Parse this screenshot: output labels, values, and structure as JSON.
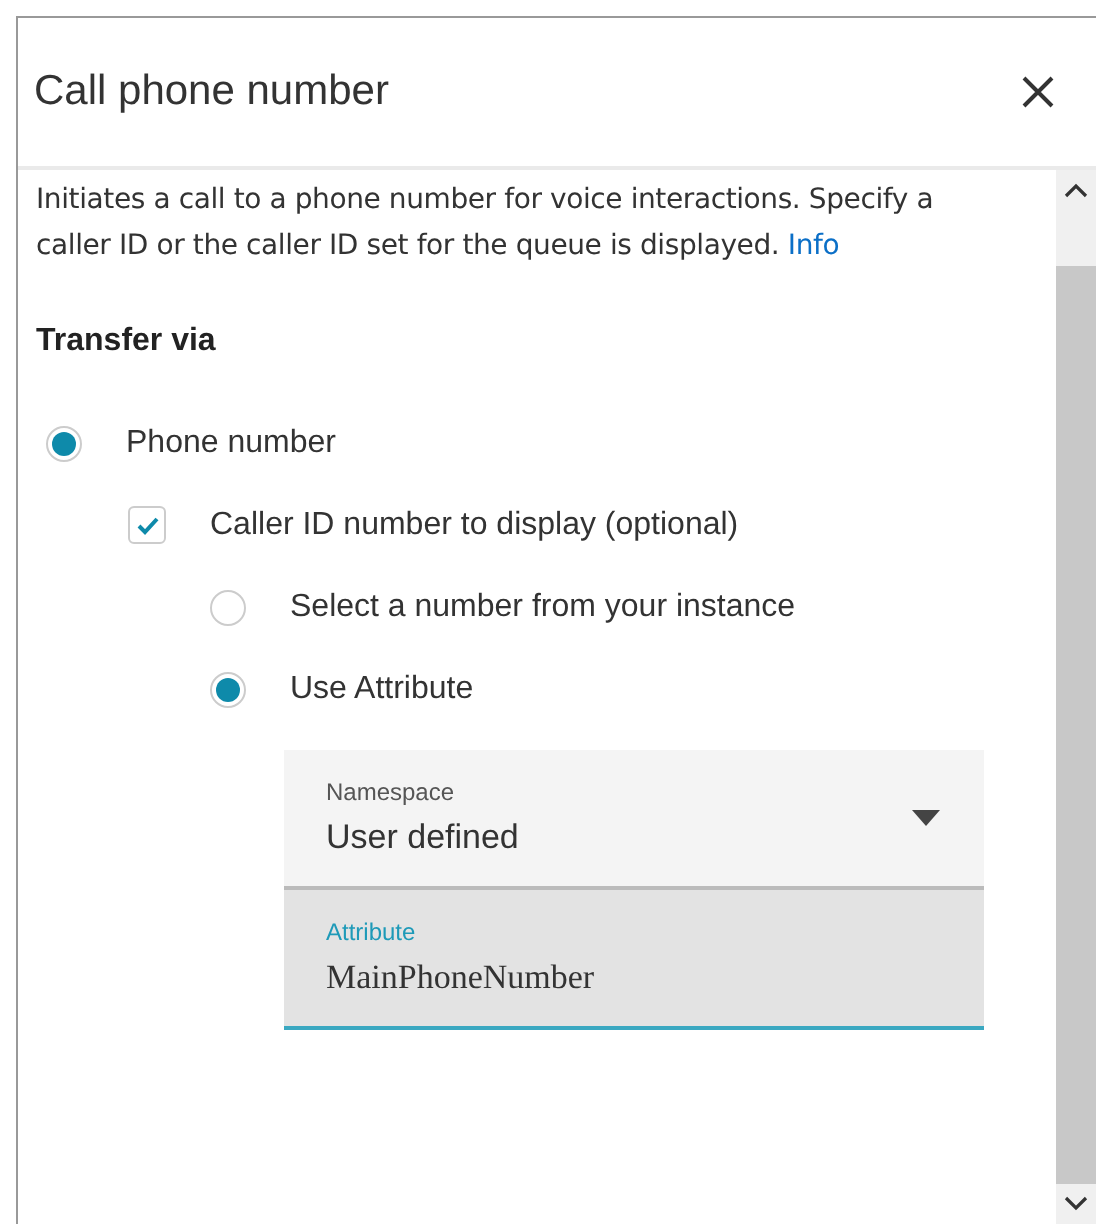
{
  "panel": {
    "title": "Call phone number",
    "description": "Initiates a call to a phone number for voice interactions. Specify a caller ID or the caller ID set for the queue is displayed.",
    "info_link": "Info"
  },
  "section": {
    "heading": "Transfer via"
  },
  "options": [
    {
      "kind": "radio",
      "label": "Phone number",
      "selected": true,
      "children": [
        {
          "kind": "checkbox",
          "label": "Caller ID number to display (optional)",
          "checked": true,
          "children": [
            {
              "kind": "radio",
              "label": "Select a number from your instance",
              "selected": false
            },
            {
              "kind": "radio",
              "label": "Use Attribute",
              "selected": true
            }
          ]
        }
      ]
    }
  ],
  "fields": [
    {
      "kind": "dropdown",
      "label": "Namespace",
      "value": "User defined",
      "focused": false
    },
    {
      "kind": "text",
      "label": "Attribute",
      "value": "MainPhoneNumber",
      "focused": true
    }
  ]
}
